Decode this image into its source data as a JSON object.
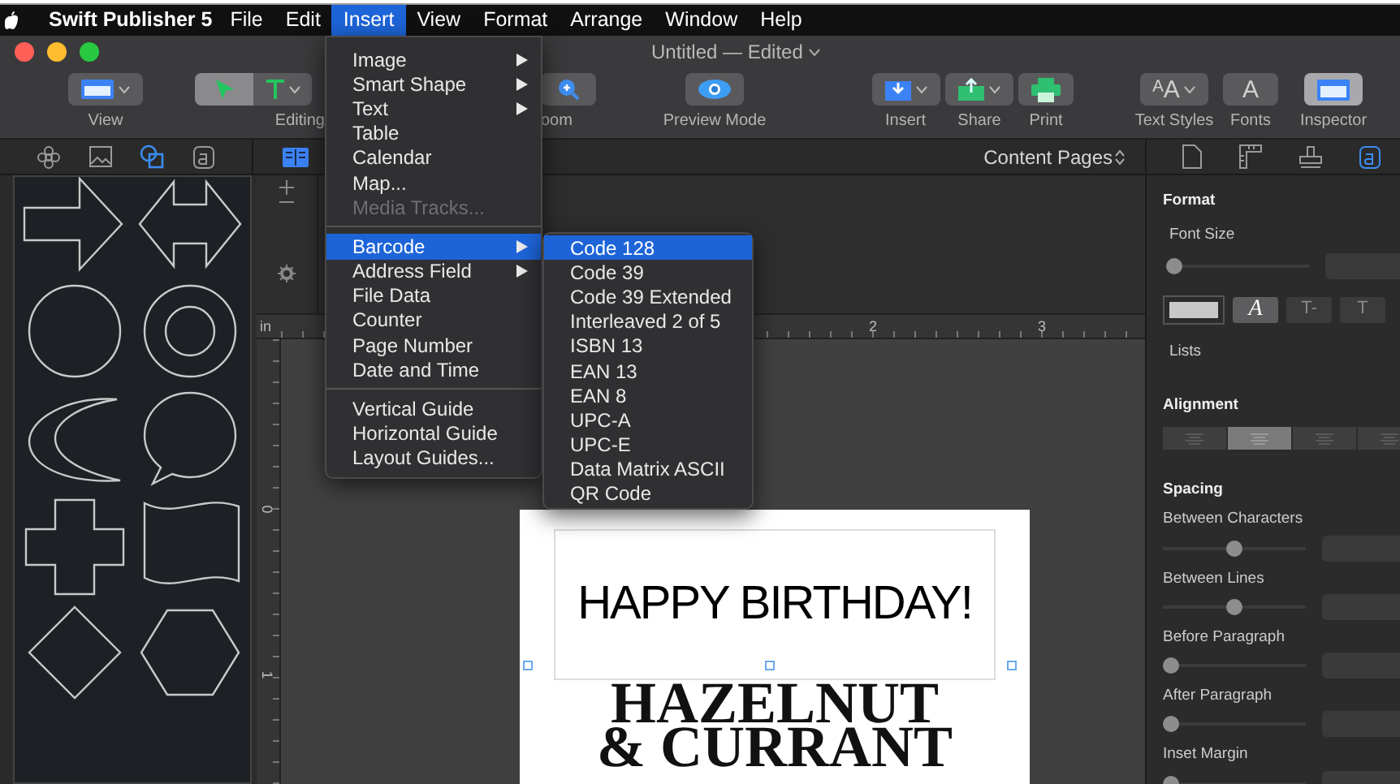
{
  "menubar": {
    "app_name": "Swift Publisher 5",
    "items": [
      {
        "label": "File",
        "selected": false
      },
      {
        "label": "Edit",
        "selected": false
      },
      {
        "label": "Insert",
        "selected": true
      },
      {
        "label": "View",
        "selected": false
      },
      {
        "label": "Format",
        "selected": false
      },
      {
        "label": "Arrange",
        "selected": false
      },
      {
        "label": "Window",
        "selected": false
      },
      {
        "label": "Help",
        "selected": false
      }
    ]
  },
  "window": {
    "title": "Untitled — Edited"
  },
  "toolbar": [
    {
      "kind": "view",
      "label": "View",
      "has_menu": true,
      "selected": false
    },
    {
      "kind": "editing",
      "label": "Editing",
      "has_menu": true,
      "selected": true
    },
    {
      "kind": "zoom",
      "label": "oom",
      "has_menu": false,
      "selected": false
    },
    {
      "kind": "preview",
      "label": "Preview Mode",
      "has_menu": false,
      "selected": false
    },
    {
      "kind": "insert",
      "label": "Insert",
      "has_menu": true,
      "selected": false
    },
    {
      "kind": "share",
      "label": "Share",
      "has_menu": true,
      "selected": false
    },
    {
      "kind": "print",
      "label": "Print",
      "has_menu": false,
      "selected": false
    },
    {
      "kind": "glyph",
      "glyph": "ᴬA",
      "label": "Text Styles",
      "has_menu": true,
      "selected": false
    },
    {
      "kind": "glyph",
      "glyph": "A",
      "label": "Fonts",
      "has_menu": false,
      "selected": false
    },
    {
      "kind": "inspector",
      "label": "Inspector",
      "has_menu": false,
      "selected": true
    }
  ],
  "library_tabs": [
    {
      "kind": "flower",
      "selected": false
    },
    {
      "kind": "image",
      "selected": false
    },
    {
      "kind": "shapes",
      "selected": true
    },
    {
      "kind": "text",
      "selected": false
    }
  ],
  "page_view": {
    "selected": true,
    "selector": "Content Pages"
  },
  "inspector_tabs": [
    {
      "kind": "page",
      "selected": false
    },
    {
      "kind": "ruler",
      "selected": false
    },
    {
      "kind": "stamp",
      "selected": false
    },
    {
      "kind": "text",
      "selected": true
    }
  ],
  "shapes": [
    {
      "kind": "arrow"
    },
    {
      "kind": "double-arrow"
    },
    {
      "kind": "circle"
    },
    {
      "kind": "ring"
    },
    {
      "kind": "crescent"
    },
    {
      "kind": "speech-bubble"
    },
    {
      "kind": "cross"
    },
    {
      "kind": "wave-flag"
    },
    {
      "kind": "diamond"
    },
    {
      "kind": "hexagon"
    }
  ],
  "rulers": {
    "unit": "in",
    "top_labels": [
      "2",
      "3"
    ],
    "left_labels": [
      "0",
      "1"
    ]
  },
  "page": {
    "headline": "HAPPY BIRTHDAY!",
    "subtitle_lines": [
      "HAZELNUT",
      "& CURRANT"
    ]
  },
  "insert_menu": {
    "groups": [
      {
        "items": [
          {
            "label": "Image",
            "has_submenu": true,
            "disabled": false,
            "selected": false
          },
          {
            "label": "Smart Shape",
            "has_submenu": true,
            "disabled": false,
            "selected": false
          },
          {
            "label": "Text",
            "has_submenu": true,
            "disabled": false,
            "selected": false
          },
          {
            "label": "Table",
            "has_submenu": false,
            "disabled": false,
            "selected": false
          },
          {
            "label": "Calendar",
            "has_submenu": false,
            "disabled": false,
            "selected": false
          },
          {
            "label": "Map...",
            "has_submenu": false,
            "disabled": false,
            "selected": false
          },
          {
            "label": "Media Tracks...",
            "has_submenu": false,
            "disabled": true,
            "selected": false
          }
        ]
      },
      {
        "items": [
          {
            "label": "Barcode",
            "has_submenu": true,
            "disabled": false,
            "selected": true
          },
          {
            "label": "Address Field",
            "has_submenu": true,
            "disabled": false,
            "selected": false
          },
          {
            "label": "File Data",
            "has_submenu": false,
            "disabled": false,
            "selected": false
          },
          {
            "label": "Counter",
            "has_submenu": false,
            "disabled": false,
            "selected": false
          },
          {
            "label": "Page Number",
            "has_submenu": false,
            "disabled": false,
            "selected": false
          },
          {
            "label": "Date and Time",
            "has_submenu": false,
            "disabled": false,
            "selected": false
          }
        ]
      },
      {
        "items": [
          {
            "label": "Vertical Guide",
            "has_submenu": false,
            "disabled": false,
            "selected": false
          },
          {
            "label": "Horizontal Guide",
            "has_submenu": false,
            "disabled": false,
            "selected": false
          },
          {
            "label": "Layout Guides...",
            "has_submenu": false,
            "disabled": false,
            "selected": false
          }
        ]
      }
    ]
  },
  "barcode_submenu": [
    {
      "label": "Code 128",
      "selected": true
    },
    {
      "label": "Code 39",
      "selected": false
    },
    {
      "label": "Code 39 Extended",
      "selected": false
    },
    {
      "label": "Interleaved 2 of 5",
      "selected": false
    },
    {
      "label": "ISBN 13",
      "selected": false
    },
    {
      "label": "EAN 13",
      "selected": false
    },
    {
      "label": "EAN 8",
      "selected": false
    },
    {
      "label": "UPC-A",
      "selected": false
    },
    {
      "label": "UPC-E",
      "selected": false
    },
    {
      "label": "Data Matrix ASCII",
      "selected": false
    },
    {
      "label": "QR Code",
      "selected": false
    }
  ],
  "inspector": {
    "format": {
      "title": "Format",
      "font_size": {
        "label": "Font Size",
        "level": 0
      },
      "lists_label": "Lists",
      "style_buttons": [
        {
          "glyph": "A",
          "selected": true
        },
        {
          "glyph": "T-",
          "selected": false
        },
        {
          "glyph": "T",
          "selected": false
        }
      ]
    },
    "alignment": {
      "title": "Alignment",
      "options": [
        {
          "selected": false
        },
        {
          "selected": true
        },
        {
          "selected": false
        },
        {
          "selected": false
        }
      ]
    },
    "spacing": {
      "title": "Spacing",
      "rows": [
        {
          "label": "Between Characters",
          "level": 0.5
        },
        {
          "label": "Between Lines",
          "level": 0.5
        },
        {
          "label": "Before Paragraph",
          "level": 0
        },
        {
          "label": "After Paragraph",
          "level": 0
        },
        {
          "label": "Inset Margin",
          "level": 0
        }
      ]
    }
  }
}
